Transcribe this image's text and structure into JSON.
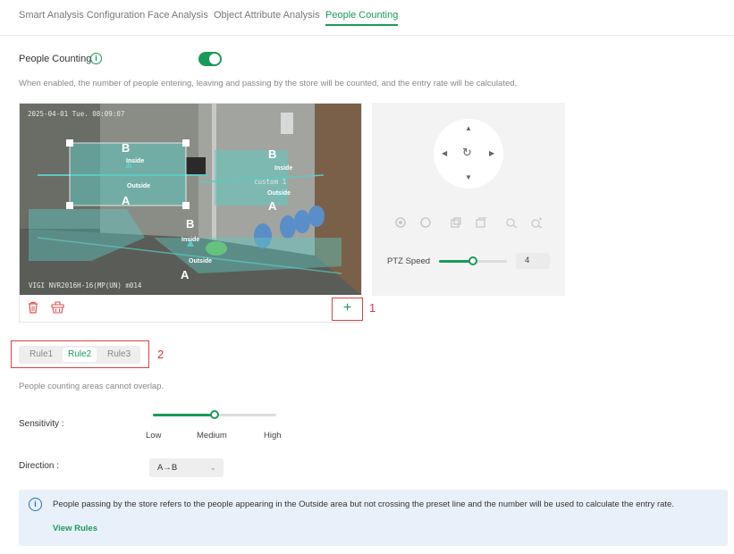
{
  "tabs": [
    {
      "label": "Smart Analysis Configuration"
    },
    {
      "label": "Face Analysis"
    },
    {
      "label": "Object Attribute Analysis"
    },
    {
      "label": "People Counting"
    }
  ],
  "people_counting": {
    "label": "People Counting",
    "enabled": true,
    "description": "When enabled, the number of people entering, leaving and passing by the store will be counted, and the entry rate will be calculated."
  },
  "video": {
    "timestamp": "2025-04-01 Tue. 08:09:07",
    "footer": "VIGI NVR2016H-16(MP(UN) m014",
    "custom_label": "custom 1",
    "zones": {
      "a": "A",
      "b": "B",
      "inside": "Inside",
      "outside": "Outside"
    }
  },
  "annotations": {
    "one": "1",
    "two": "2"
  },
  "add_button": "+",
  "ptz": {
    "speed_label": "PTZ Speed",
    "speed_value": "4",
    "speed_level": 0.5
  },
  "rules": [
    {
      "label": "Rule1"
    },
    {
      "label": "Rule2"
    },
    {
      "label": "Rule3"
    }
  ],
  "note": "People counting areas cannot overlap.",
  "sensitivity": {
    "label": "Sensitivity :",
    "ticks": [
      "Low",
      "Medium",
      "High"
    ],
    "value": "Medium"
  },
  "direction": {
    "label": "Direction :",
    "value": "A→B"
  },
  "info": {
    "text": "People passing by the store refers to the people appearing in the Outside area but not crossing the preset line and the number will be used to calculate the entry rate.",
    "link": "View Rules"
  },
  "colors": {
    "accent": "#1a9a5a",
    "zone_fill": "#5fc8c0",
    "highlight_border": "#e04040",
    "info_bg": "#e8f0fa"
  },
  "icons": [
    "info-icon",
    "delete-icon",
    "clear-all-icon",
    "add-icon",
    "refresh-icon",
    "chevron-down-icon"
  ]
}
